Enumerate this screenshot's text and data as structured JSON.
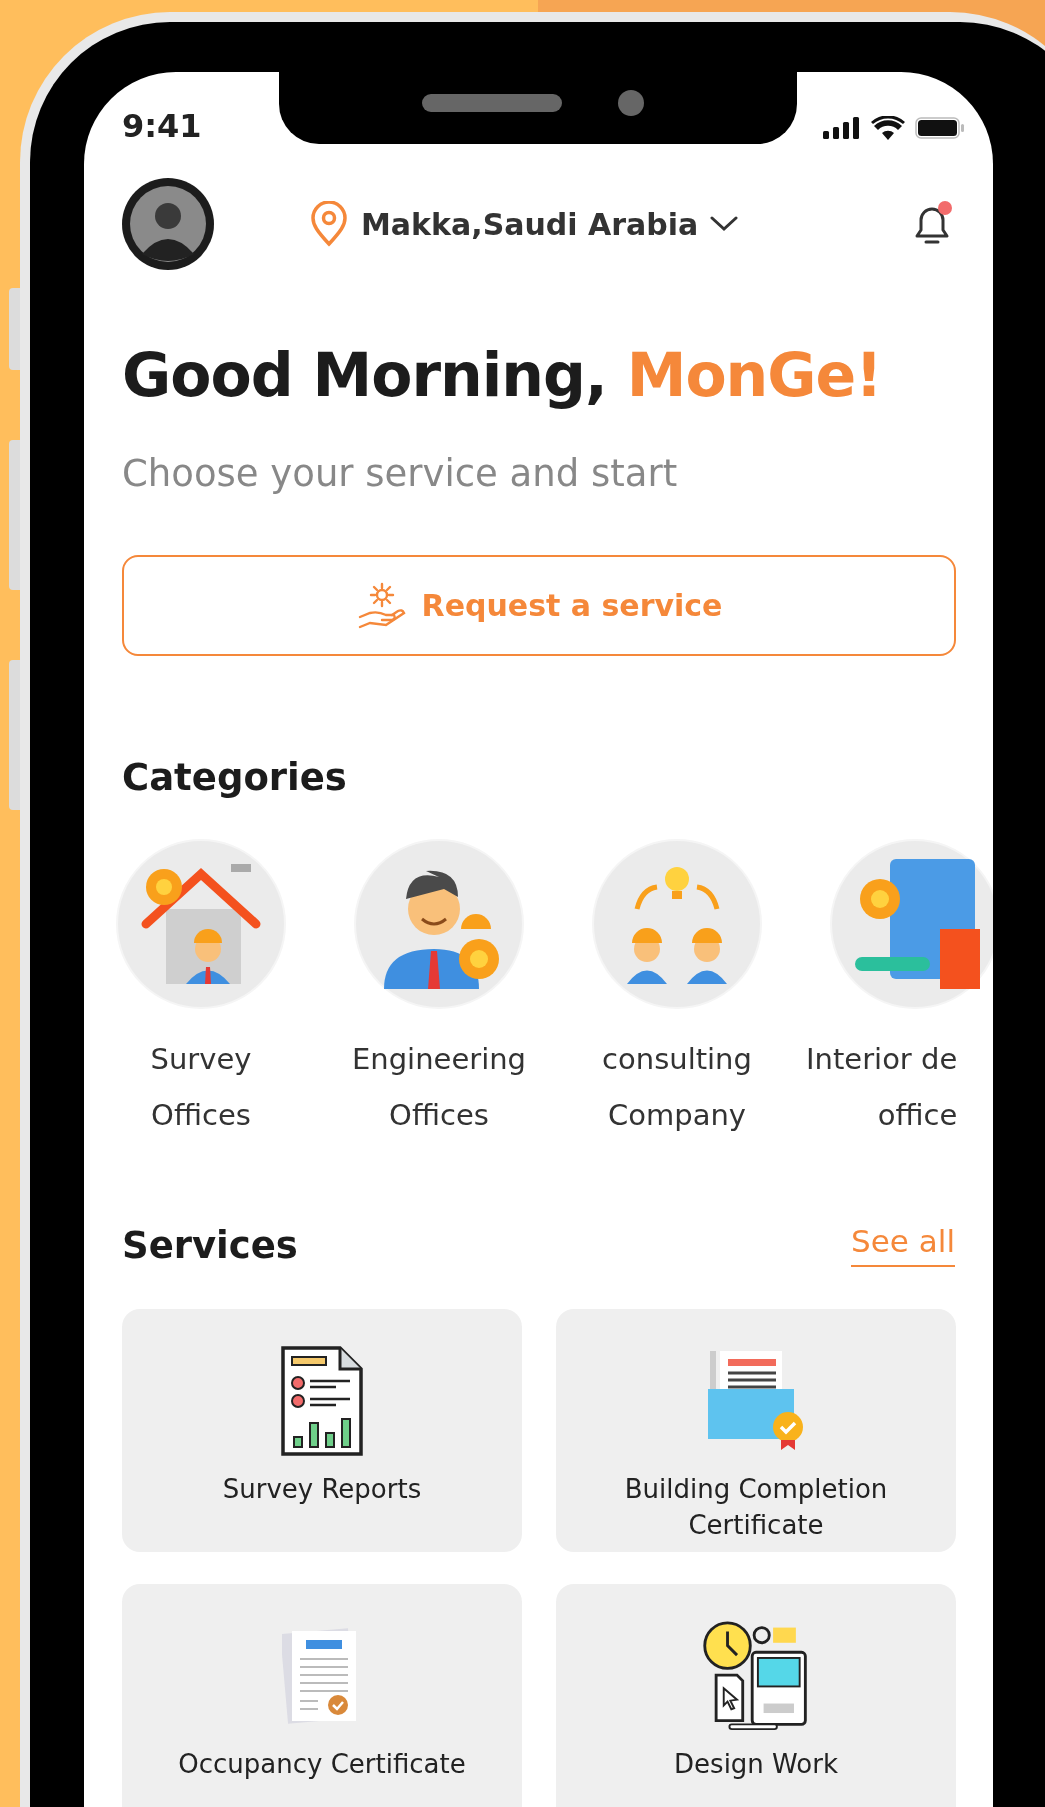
{
  "status_bar": {
    "time": "9:41"
  },
  "header": {
    "location": "Makka,Saudi Arabia",
    "notification_unread": true
  },
  "greeting": {
    "text": "Good Morning,",
    "name": "MonGe!"
  },
  "subtitle": "Choose your service and start",
  "request_button": {
    "label": "Request a service"
  },
  "categories": {
    "title": "Categories",
    "items": [
      {
        "lines": [
          "Survey",
          "Offices"
        ]
      },
      {
        "lines": [
          "Engineering",
          "Offices"
        ]
      },
      {
        "lines": [
          "consulting",
          "Company"
        ]
      },
      {
        "lines": [
          "Interior de",
          "office"
        ]
      }
    ]
  },
  "services": {
    "title": "Services",
    "see_all": "See all",
    "items": [
      {
        "label": "Survey Reports"
      },
      {
        "label": "Building Completion Certificate"
      },
      {
        "label": "Occupancy Certificate"
      },
      {
        "label": "Design Work"
      }
    ]
  }
}
